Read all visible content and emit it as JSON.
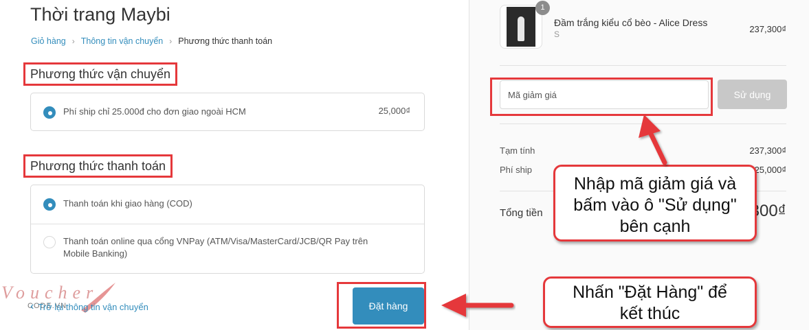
{
  "shop": {
    "title": "Thời trang Maybi"
  },
  "breadcrumb": {
    "items": [
      "Giỏ hàng",
      "Thông tin vận chuyển",
      "Phương thức thanh toán"
    ]
  },
  "shipping": {
    "title": "Phương thức vận chuyển",
    "options": [
      {
        "label": "Phí ship chỉ 25.000đ cho đơn giao ngoài HCM",
        "price": "25,000₫",
        "selected": true
      }
    ]
  },
  "payment": {
    "title": "Phương thức thanh toán",
    "options": [
      {
        "label": "Thanh toán khi giao hàng (COD)",
        "selected": true
      },
      {
        "label_line1": "Thanh toán online qua cổng VNPay (ATM/Visa/MasterCard/JCB/QR Pay trên",
        "label_line2": "Mobile Banking)",
        "selected": false
      }
    ]
  },
  "footer": {
    "back_label": "Trở lại thông tin vận chuyển",
    "order_label": "Đặt hàng"
  },
  "watermark": {
    "brand": "Voucher",
    "sub": "CODE.VN"
  },
  "cart": {
    "items": [
      {
        "name": "Đầm trắng kiểu cổ bèo - Alice Dress",
        "variant": "S",
        "price": "237,300₫",
        "quantity": "1"
      }
    ]
  },
  "discount": {
    "placeholder": "Mã giảm giá",
    "button_label": "Sử dụng"
  },
  "summary": {
    "subtotal_label": "Tạm tính",
    "subtotal_value": "237,300₫",
    "shipping_label": "Phí ship",
    "shipping_value": "25,000₫",
    "total_label": "Tổng tiền",
    "total_value": "262,300₫"
  },
  "annotations": {
    "discount_callout": [
      "Nhập mã giảm giá và",
      "bấm vào ô \"Sử dụng\"",
      "bên cạnh"
    ],
    "order_callout": [
      "Nhấn \"Đặt Hàng\" để",
      "kết thúc"
    ]
  },
  "colors": {
    "accent": "#338dbc",
    "highlight_red": "#e5383b",
    "disabled_button": "#c8c8c8"
  }
}
